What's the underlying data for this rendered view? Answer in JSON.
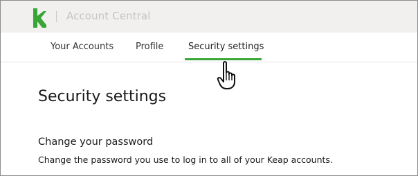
{
  "header": {
    "logo_icon": "keap-logo-icon",
    "app_title": "Account Central",
    "brand_color": "#37a635"
  },
  "nav": {
    "tabs": [
      {
        "label": "Your Accounts",
        "active": false
      },
      {
        "label": "Profile",
        "active": false
      },
      {
        "label": "Security settings",
        "active": true
      }
    ],
    "active_underline_color": "#37a635"
  },
  "main": {
    "page_title": "Security settings",
    "sections": [
      {
        "title": "Change your password",
        "description": "Change the password you use to log in to all of your Keap accounts."
      }
    ]
  },
  "cursor": {
    "icon": "hand-pointer-icon"
  }
}
